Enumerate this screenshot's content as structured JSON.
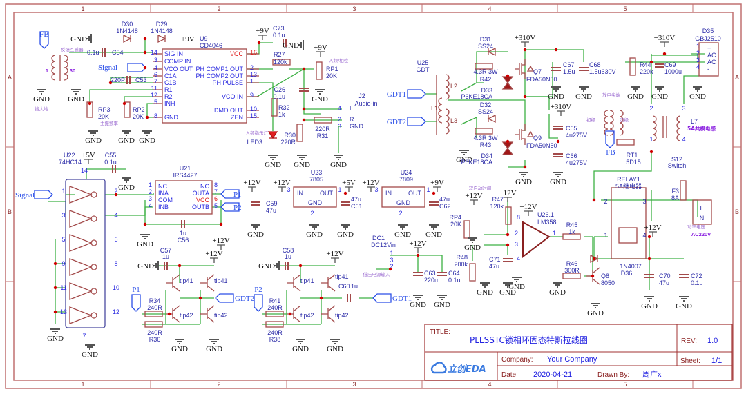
{
  "frame": {
    "columns": [
      "1",
      "2",
      "3",
      "4",
      "5"
    ],
    "rows": [
      "A",
      "B"
    ]
  },
  "title_block": {
    "title_label": "TITLE:",
    "title": "PLLSSTC锁相环固态特斯拉线圈",
    "rev_label": "REV:",
    "rev": "1.0",
    "company_label": "Company:",
    "company": "Your Company",
    "sheet_label": "Sheet:",
    "sheet": "1/1",
    "date_label": "Date:",
    "date": "2020-04-21",
    "drawn_label": "Drawn By:",
    "drawn_by": "周广x",
    "logo": "立创EDA"
  },
  "nets": {
    "gnd": "GND",
    "v5": "+5V",
    "v9": "+9V",
    "v12": "+12V",
    "v310": "+310V"
  },
  "ports": {
    "fb": "FB",
    "signal": "Signal",
    "gdt1": "GDT1",
    "gdt2": "GDT2",
    "p1": "P1",
    "p2": "P2"
  },
  "notes": {
    "feedback_ct": "反馈互感器",
    "earth": "接大地",
    "main_freq": "主振频率",
    "in_phase": "入频/相位",
    "lock_led": "入频指示灯",
    "discharge_tip": "放电尖端",
    "primary": "初级",
    "secondary": "次级",
    "cm_choke": "5A共模电感",
    "relay_note": "5A继电器",
    "soft_start": "软启动时间",
    "lv_input": "低压电源输入",
    "power_voltage": "功率电压",
    "ac220": "AC220V",
    "ct_turns_1": "1",
    "ct_turns_30": "30"
  },
  "components": {
    "U9": {
      "ref": "U9",
      "value": "CD4046",
      "left_pins": [
        {
          "n": "14",
          "name": "SIG IN"
        },
        {
          "n": "3",
          "name": "COMP IN"
        },
        {
          "n": "4",
          "name": "VCO OUT"
        },
        {
          "n": "6",
          "name": "C1A"
        },
        {
          "n": "7",
          "name": "C1B"
        },
        {
          "n": "11",
          "name": "R1"
        },
        {
          "n": "12",
          "name": "R2"
        },
        {
          "n": "5",
          "name": "INH"
        },
        {
          "n": "8",
          "name": "GND"
        }
      ],
      "right_pins": [
        {
          "n": "16",
          "name": "VCC"
        },
        {
          "n": "2",
          "name": "PH COMP1 OUT"
        },
        {
          "n": "13",
          "name": "PH COMP2 OUT"
        },
        {
          "n": "1",
          "name": "PH PULSE"
        },
        {
          "n": "9",
          "name": "VCO IN"
        },
        {
          "n": "10",
          "name": "DMD OUT"
        },
        {
          "n": "15",
          "name": "ZEN"
        }
      ]
    },
    "D30": {
      "ref": "D30",
      "value": "1N4148"
    },
    "D29": {
      "ref": "D29",
      "value": "1N4148"
    },
    "C54": {
      "ref": "C54",
      "value": "0.1u"
    },
    "C53": {
      "ref": "C53",
      "value": "220P"
    },
    "RP3": {
      "ref": "RP3",
      "value": "20K"
    },
    "RP2": {
      "ref": "RP2",
      "value": "20K"
    },
    "C73": {
      "ref": "C73",
      "value": "0.1u"
    },
    "R27": {
      "ref": "R27",
      "value": "120k"
    },
    "RP1": {
      "ref": "RP1",
      "value": "20K"
    },
    "C26": {
      "ref": "C26",
      "value": "0.1u"
    },
    "R32": {
      "ref": "R32",
      "value": "1k"
    },
    "LED3": {
      "ref": "LED3"
    },
    "R30": {
      "ref": "R30",
      "value": "220R"
    },
    "R31": {
      "ref": "R31",
      "value": "220R"
    },
    "J2": {
      "ref": "J2",
      "value": "Audio-in",
      "pins": [
        {
          "n": "4",
          "name": "L"
        },
        {
          "n": "2",
          "name": "R"
        },
        {
          "n": "3",
          "name": "GND"
        }
      ]
    },
    "U25": {
      "ref": "U25",
      "value": "GDT",
      "coils": [
        "L1",
        "L2",
        "L3"
      ]
    },
    "D31": {
      "ref": "D31",
      "value": "SS24"
    },
    "D32": {
      "ref": "D32",
      "value": "SS24"
    },
    "R42": {
      "ref": "R42",
      "value": "4.3R 3W"
    },
    "R43": {
      "ref": "R43",
      "value": "4.3R 3W"
    },
    "D33": {
      "ref": "D33",
      "value": "P6KE18CA"
    },
    "D34": {
      "ref": "D34",
      "value": "P6KE18CA"
    },
    "Q7": {
      "ref": "Q7",
      "value": "FDA50N50"
    },
    "Q9": {
      "ref": "Q9",
      "value": "FDA50N50"
    },
    "C67": {
      "ref": "C67",
      "value": "1.5u"
    },
    "C68": {
      "ref": "C68",
      "value": "1.5u630V"
    },
    "C65": {
      "ref": "C65",
      "value": "4u275V"
    },
    "C66": {
      "ref": "C66",
      "value": "4u275V"
    },
    "R44": {
      "ref": "R44",
      "value": "220k"
    },
    "C69": {
      "ref": "C69",
      "value": "1000u"
    },
    "D35": {
      "ref": "D35",
      "value": "GBJ2510",
      "pins": [
        {
          "n": "1",
          "name": "+"
        },
        {
          "n": "2",
          "name": "AC"
        },
        {
          "n": "3",
          "name": "AC"
        },
        {
          "n": "4",
          "name": "-"
        }
      ]
    },
    "L7": {
      "ref": "L7",
      "pins": [
        "2",
        "3",
        "1",
        "4"
      ]
    },
    "S12": {
      "ref": "S12",
      "value": "Switch"
    },
    "RT1": {
      "ref": "RT1",
      "value": "5D15"
    },
    "RELAY1": {
      "ref": "RELAY1",
      "pins": [
        "2",
        "3",
        "1",
        "4"
      ]
    },
    "F3": {
      "ref": "F3",
      "value": "8A"
    },
    "LN": {
      "l": "L",
      "n": "N"
    },
    "U22": {
      "ref": "U22",
      "value": "74HC14",
      "pins": [
        "1",
        "2",
        "3",
        "4",
        "5",
        "6",
        "9",
        "8",
        "11",
        "10",
        "13",
        "12",
        "14",
        "7"
      ]
    },
    "C55": {
      "ref": "C55",
      "value": "0.1u"
    },
    "U21": {
      "ref": "U21",
      "value": "IRS4427",
      "left_pins": [
        {
          "n": "1",
          "name": "NC"
        },
        {
          "n": "2",
          "name": "INA"
        },
        {
          "n": "3",
          "name": "COM"
        },
        {
          "n": "4",
          "name": "INB"
        }
      ],
      "right_pins": [
        {
          "n": "8",
          "name": "NC"
        },
        {
          "n": "7",
          "name": "OUTA"
        },
        {
          "n": "6",
          "name": "VCC"
        },
        {
          "n": "5",
          "name": "OUTB"
        }
      ]
    },
    "C56": {
      "ref": "C56",
      "value": "1u"
    },
    "C59": {
      "ref": "C59",
      "value": "47u"
    },
    "U23": {
      "ref": "U23",
      "value": "7805",
      "in": "IN",
      "out": "OUT",
      "gnd": "GND",
      "pins": [
        "3",
        "1",
        "2"
      ]
    },
    "C61": {
      "ref": "C61",
      "value": "47u"
    },
    "U24": {
      "ref": "U24",
      "value": "7809",
      "in": "IN",
      "out": "OUT",
      "gnd": "GND",
      "pins": [
        "3",
        "1",
        "2"
      ]
    },
    "C62": {
      "ref": "C62",
      "value": "47u"
    },
    "DC1": {
      "ref": "DC1",
      "value": "DC12Vin",
      "pins": [
        "1",
        "3",
        "2"
      ]
    },
    "C63": {
      "ref": "C63",
      "value": "220u"
    },
    "C64": {
      "ref": "C64",
      "value": "0.1u"
    },
    "RP4": {
      "ref": "RP4",
      "value": "20K"
    },
    "R47": {
      "ref": "R47",
      "value": "120k"
    },
    "R48": {
      "ref": "R48",
      "value": "200k"
    },
    "C71": {
      "ref": "C71",
      "value": "47u"
    },
    "U26": {
      "ref": "U26.1",
      "value": "LM358",
      "pins": [
        "8",
        "2",
        "3",
        "1",
        "4"
      ]
    },
    "R45": {
      "ref": "R45",
      "value": "1k"
    },
    "R46": {
      "ref": "R46",
      "value": "300R"
    },
    "Q8": {
      "ref": "Q8",
      "value": "8050"
    },
    "D36": {
      "ref": "D36",
      "value": "1N4007"
    },
    "C70": {
      "ref": "C70",
      "value": "47u"
    },
    "C72": {
      "ref": "C72",
      "value": "0.1u"
    },
    "C57": {
      "ref": "C57",
      "value": "1u"
    },
    "C58": {
      "ref": "C58",
      "value": "1u"
    },
    "C60": {
      "ref": "C60",
      "value": "1u"
    },
    "R34": {
      "ref": "R34",
      "value": "240R"
    },
    "R36": {
      "ref": "R36",
      "value": "240R"
    },
    "R41": {
      "ref": "R41",
      "value": "240R"
    },
    "R38": {
      "ref": "R38",
      "value": "240R"
    },
    "tip41": "tip41",
    "tip42": "tip42"
  },
  "colors": {
    "wire": "#3cb043",
    "part": "#a34a4a",
    "label": "#2b2ba8",
    "frame": "#b05050",
    "junction": "#d00000"
  }
}
